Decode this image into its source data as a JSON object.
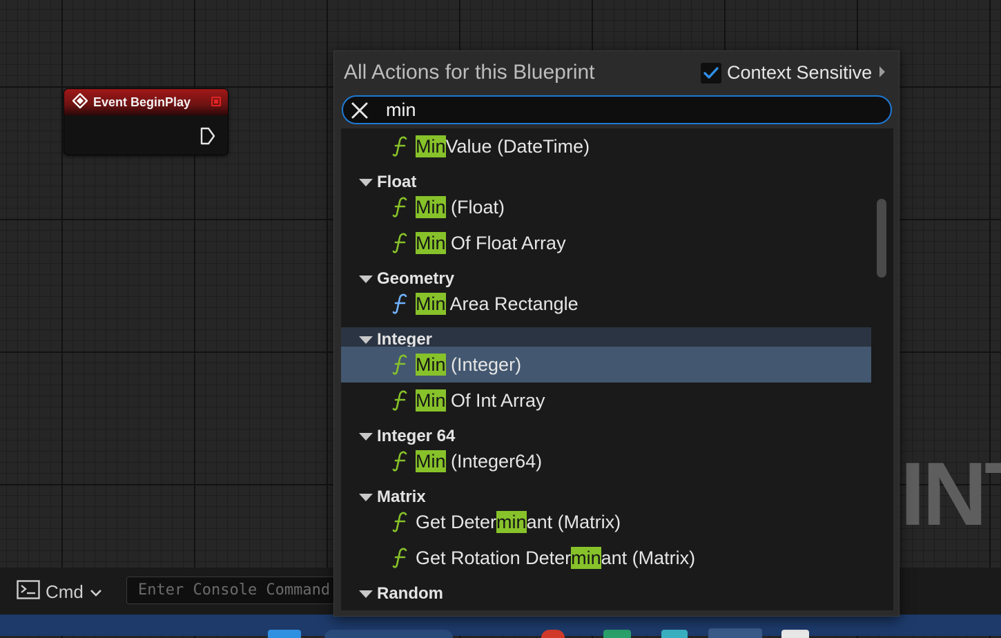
{
  "graph": {
    "watermark": "INT",
    "node": {
      "title": "Event BeginPlay"
    }
  },
  "console": {
    "cmd_label": "Cmd",
    "placeholder": "Enter Console Command"
  },
  "action_menu": {
    "title": "All Actions for this Blueprint",
    "context_sensitive": {
      "label": "Context Sensitive",
      "checked": true
    },
    "search": {
      "value": "min"
    },
    "rows": [
      {
        "kind": "fn",
        "pre": "",
        "match": "Min",
        "post": "Value (DateTime)",
        "icon_color": "#87c22a"
      },
      {
        "kind": "cat",
        "label": "Float"
      },
      {
        "kind": "fn",
        "pre": "",
        "match": "Min",
        "post": " (Float)",
        "icon_color": "#87c22a"
      },
      {
        "kind": "fn",
        "pre": "",
        "match": "Min",
        "post": " Of Float Array",
        "icon_color": "#87c22a"
      },
      {
        "kind": "cat",
        "label": "Geometry"
      },
      {
        "kind": "fn",
        "pre": "",
        "match": "Min",
        "post": " Area Rectangle",
        "icon_color": "#6fb2ff"
      },
      {
        "kind": "cat",
        "label": "Integer",
        "highlighted": true
      },
      {
        "kind": "fn",
        "pre": "",
        "match": "Min",
        "post": " (Integer)",
        "icon_color": "#87c22a",
        "selected": true
      },
      {
        "kind": "fn",
        "pre": "",
        "match": "Min",
        "post": " Of Int Array",
        "icon_color": "#87c22a"
      },
      {
        "kind": "cat",
        "label": "Integer 64"
      },
      {
        "kind": "fn",
        "pre": "",
        "match": "Min",
        "post": " (Integer64)",
        "icon_color": "#87c22a"
      },
      {
        "kind": "cat",
        "label": "Matrix"
      },
      {
        "kind": "fn",
        "pre": "Get Deter",
        "match": "min",
        "post": "ant (Matrix)",
        "icon_color": "#87c22a"
      },
      {
        "kind": "fn",
        "pre": "Get Rotation Deter",
        "match": "min",
        "post": "ant (Matrix)",
        "icon_color": "#87c22a"
      },
      {
        "kind": "cat",
        "label": "Random"
      }
    ]
  },
  "colors": {
    "accent": "#1e7ad6",
    "match_highlight": "#87c22a",
    "selection": "#435770"
  }
}
